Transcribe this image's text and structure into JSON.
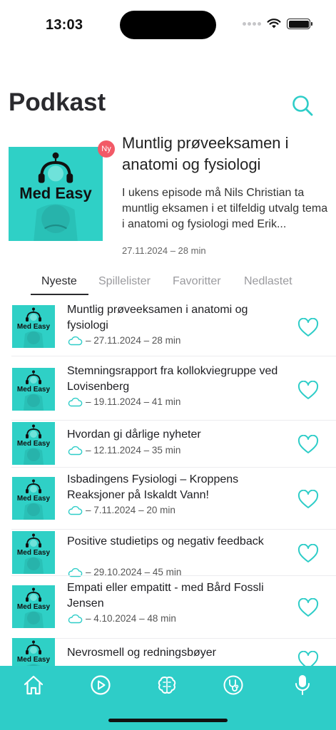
{
  "status_bar": {
    "time": "13:03"
  },
  "header": {
    "title": "Podkast"
  },
  "featured": {
    "cover_text": "Med Easy",
    "badge": "Ny",
    "title": "Muntlig prøveeksamen i anatomi og fysiologi",
    "description": "I ukens episode må Nils Christian ta muntlig eksamen i et tilfeldig utvalg tema i anatomi og fysiologi med Erik...",
    "meta": "27.11.2024 –  28 min"
  },
  "tabs": [
    {
      "label": "Nyeste"
    },
    {
      "label": "Spillelister"
    },
    {
      "label": "Favoritter"
    },
    {
      "label": "Nedlastet"
    }
  ],
  "episodes": [
    {
      "cover_text": "Med Easy",
      "title": "Muntlig prøveeksamen i anatomi og fysiologi",
      "meta": "– 27.11.2024 – 28 min"
    },
    {
      "cover_text": "Med Easy",
      "title": "Stemningsrapport fra kollokviegruppe ved Lovisenberg",
      "meta": "– 19.11.2024 – 41 min"
    },
    {
      "cover_text": "Med Easy",
      "title": "Hvordan gi dårlige nyheter",
      "meta": "– 12.11.2024 – 35 min"
    },
    {
      "cover_text": "Med Easy",
      "title": "Isbadingens Fysiologi – Kroppens Reaksjoner på Iskaldt Vann!",
      "meta": "– 7.11.2024 – 20 min"
    },
    {
      "cover_text": "Med Easy",
      "title": "Positive studietips og negativ feedback",
      "meta": "– 29.10.2024 – 45 min"
    },
    {
      "cover_text": "Med Easy",
      "title": "Empati eller empatitt - med Bård Fossli Jensen",
      "meta": "– 4.10.2024 – 48 min"
    },
    {
      "cover_text": "Med Easy",
      "title": "Nevrosmell og redningsbøyer",
      "meta": ""
    }
  ],
  "colors": {
    "accent": "#2ecdc8",
    "badge": "#f25a67",
    "text": "#2a2a2e"
  },
  "icons": {
    "search": "search-icon",
    "heart": "heart-icon",
    "cloud": "cloud-icon",
    "home": "home-icon",
    "play": "play-icon",
    "brain": "brain-icon",
    "stethoscope": "stethoscope-icon",
    "microphone": "microphone-icon"
  }
}
